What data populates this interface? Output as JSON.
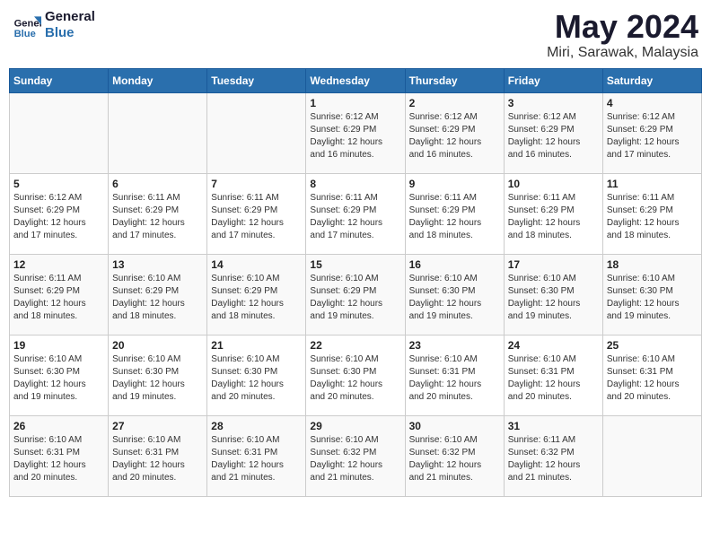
{
  "header": {
    "logo_line1": "General",
    "logo_line2": "Blue",
    "month": "May 2024",
    "location": "Miri, Sarawak, Malaysia"
  },
  "weekdays": [
    "Sunday",
    "Monday",
    "Tuesday",
    "Wednesday",
    "Thursday",
    "Friday",
    "Saturday"
  ],
  "weeks": [
    [
      {
        "day": "",
        "info": ""
      },
      {
        "day": "",
        "info": ""
      },
      {
        "day": "",
        "info": ""
      },
      {
        "day": "1",
        "info": "Sunrise: 6:12 AM\nSunset: 6:29 PM\nDaylight: 12 hours\nand 16 minutes."
      },
      {
        "day": "2",
        "info": "Sunrise: 6:12 AM\nSunset: 6:29 PM\nDaylight: 12 hours\nand 16 minutes."
      },
      {
        "day": "3",
        "info": "Sunrise: 6:12 AM\nSunset: 6:29 PM\nDaylight: 12 hours\nand 16 minutes."
      },
      {
        "day": "4",
        "info": "Sunrise: 6:12 AM\nSunset: 6:29 PM\nDaylight: 12 hours\nand 17 minutes."
      }
    ],
    [
      {
        "day": "5",
        "info": "Sunrise: 6:12 AM\nSunset: 6:29 PM\nDaylight: 12 hours\nand 17 minutes."
      },
      {
        "day": "6",
        "info": "Sunrise: 6:11 AM\nSunset: 6:29 PM\nDaylight: 12 hours\nand 17 minutes."
      },
      {
        "day": "7",
        "info": "Sunrise: 6:11 AM\nSunset: 6:29 PM\nDaylight: 12 hours\nand 17 minutes."
      },
      {
        "day": "8",
        "info": "Sunrise: 6:11 AM\nSunset: 6:29 PM\nDaylight: 12 hours\nand 17 minutes."
      },
      {
        "day": "9",
        "info": "Sunrise: 6:11 AM\nSunset: 6:29 PM\nDaylight: 12 hours\nand 18 minutes."
      },
      {
        "day": "10",
        "info": "Sunrise: 6:11 AM\nSunset: 6:29 PM\nDaylight: 12 hours\nand 18 minutes."
      },
      {
        "day": "11",
        "info": "Sunrise: 6:11 AM\nSunset: 6:29 PM\nDaylight: 12 hours\nand 18 minutes."
      }
    ],
    [
      {
        "day": "12",
        "info": "Sunrise: 6:11 AM\nSunset: 6:29 PM\nDaylight: 12 hours\nand 18 minutes."
      },
      {
        "day": "13",
        "info": "Sunrise: 6:10 AM\nSunset: 6:29 PM\nDaylight: 12 hours\nand 18 minutes."
      },
      {
        "day": "14",
        "info": "Sunrise: 6:10 AM\nSunset: 6:29 PM\nDaylight: 12 hours\nand 18 minutes."
      },
      {
        "day": "15",
        "info": "Sunrise: 6:10 AM\nSunset: 6:29 PM\nDaylight: 12 hours\nand 19 minutes."
      },
      {
        "day": "16",
        "info": "Sunrise: 6:10 AM\nSunset: 6:30 PM\nDaylight: 12 hours\nand 19 minutes."
      },
      {
        "day": "17",
        "info": "Sunrise: 6:10 AM\nSunset: 6:30 PM\nDaylight: 12 hours\nand 19 minutes."
      },
      {
        "day": "18",
        "info": "Sunrise: 6:10 AM\nSunset: 6:30 PM\nDaylight: 12 hours\nand 19 minutes."
      }
    ],
    [
      {
        "day": "19",
        "info": "Sunrise: 6:10 AM\nSunset: 6:30 PM\nDaylight: 12 hours\nand 19 minutes."
      },
      {
        "day": "20",
        "info": "Sunrise: 6:10 AM\nSunset: 6:30 PM\nDaylight: 12 hours\nand 19 minutes."
      },
      {
        "day": "21",
        "info": "Sunrise: 6:10 AM\nSunset: 6:30 PM\nDaylight: 12 hours\nand 20 minutes."
      },
      {
        "day": "22",
        "info": "Sunrise: 6:10 AM\nSunset: 6:30 PM\nDaylight: 12 hours\nand 20 minutes."
      },
      {
        "day": "23",
        "info": "Sunrise: 6:10 AM\nSunset: 6:31 PM\nDaylight: 12 hours\nand 20 minutes."
      },
      {
        "day": "24",
        "info": "Sunrise: 6:10 AM\nSunset: 6:31 PM\nDaylight: 12 hours\nand 20 minutes."
      },
      {
        "day": "25",
        "info": "Sunrise: 6:10 AM\nSunset: 6:31 PM\nDaylight: 12 hours\nand 20 minutes."
      }
    ],
    [
      {
        "day": "26",
        "info": "Sunrise: 6:10 AM\nSunset: 6:31 PM\nDaylight: 12 hours\nand 20 minutes."
      },
      {
        "day": "27",
        "info": "Sunrise: 6:10 AM\nSunset: 6:31 PM\nDaylight: 12 hours\nand 20 minutes."
      },
      {
        "day": "28",
        "info": "Sunrise: 6:10 AM\nSunset: 6:31 PM\nDaylight: 12 hours\nand 21 minutes."
      },
      {
        "day": "29",
        "info": "Sunrise: 6:10 AM\nSunset: 6:32 PM\nDaylight: 12 hours\nand 21 minutes."
      },
      {
        "day": "30",
        "info": "Sunrise: 6:10 AM\nSunset: 6:32 PM\nDaylight: 12 hours\nand 21 minutes."
      },
      {
        "day": "31",
        "info": "Sunrise: 6:11 AM\nSunset: 6:32 PM\nDaylight: 12 hours\nand 21 minutes."
      },
      {
        "day": "",
        "info": ""
      }
    ]
  ]
}
